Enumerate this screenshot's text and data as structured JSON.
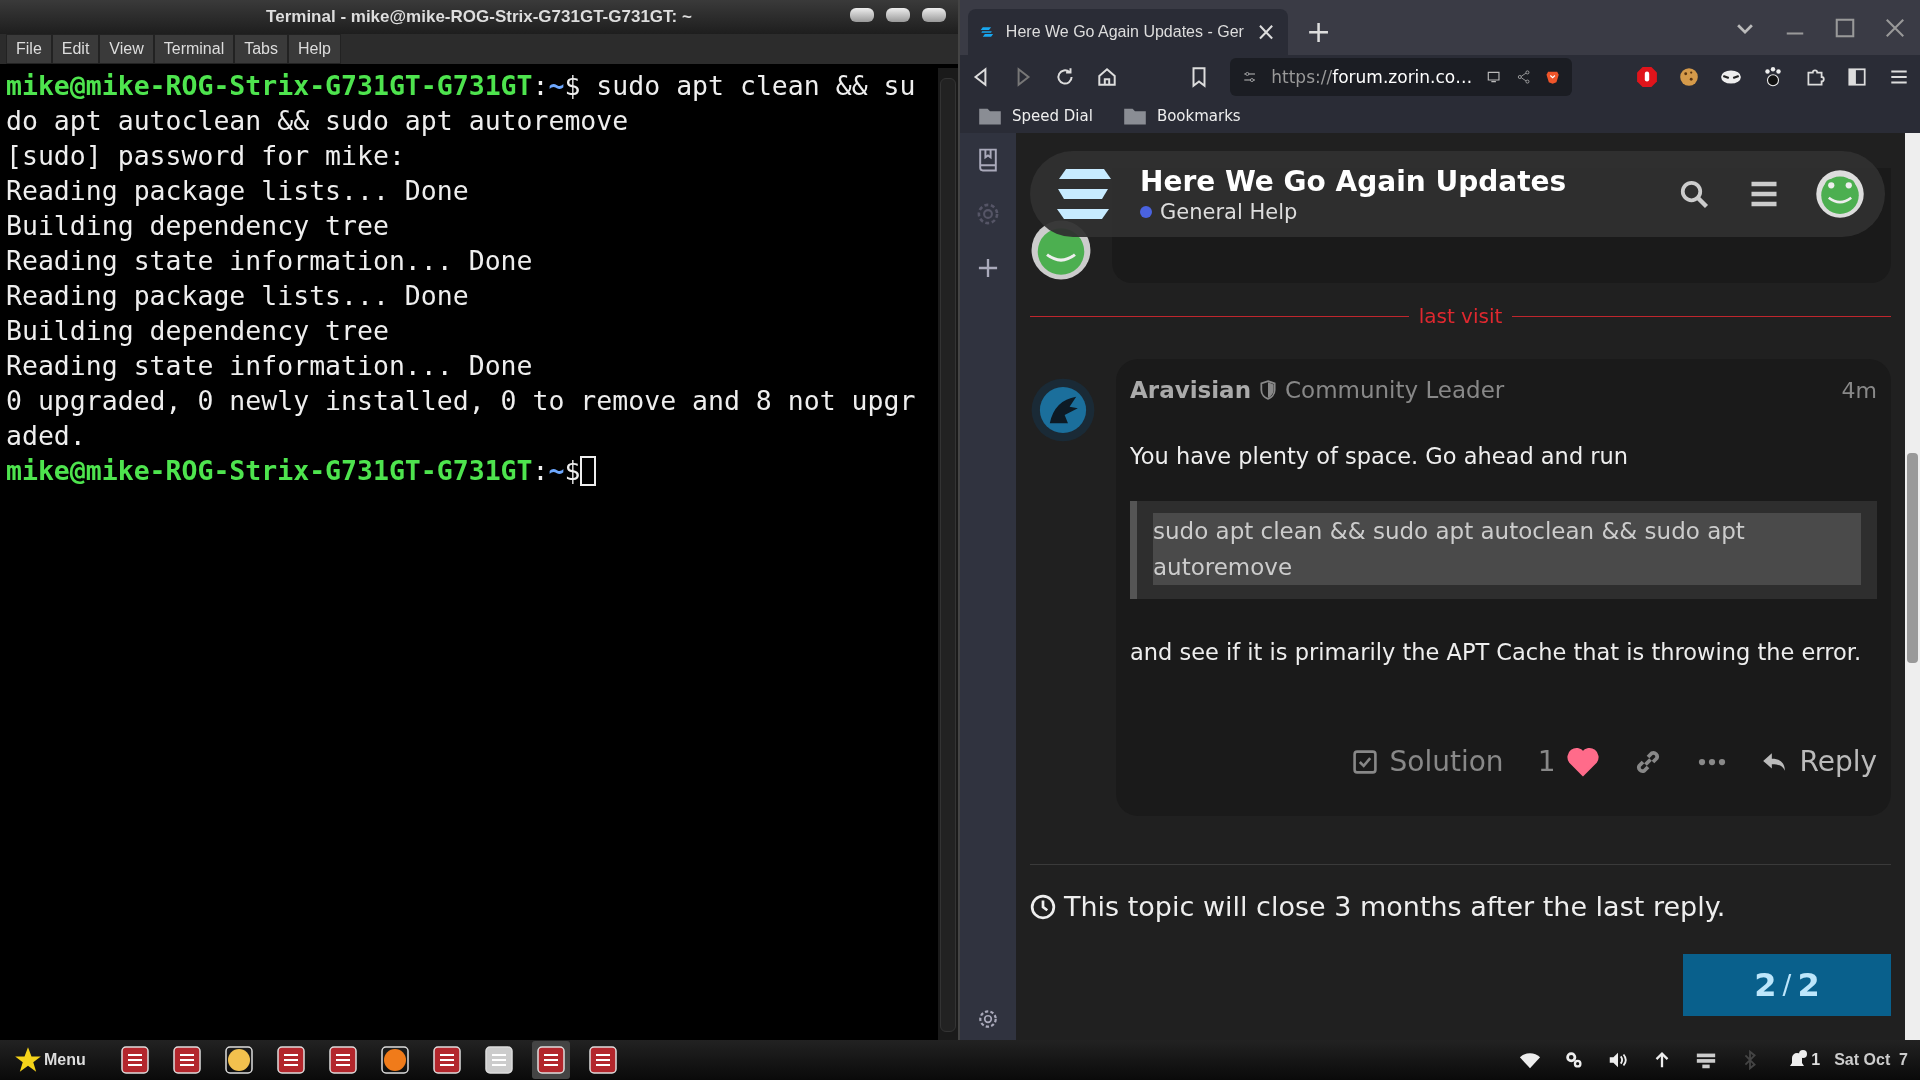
{
  "terminal": {
    "title": "Terminal - mike@mike-ROG-Strix-G731GT-G731GT: ~",
    "menu": [
      "File",
      "Edit",
      "View",
      "Terminal",
      "Tabs",
      "Help"
    ],
    "lines": [
      {
        "kind": "prompt",
        "user": "mike@mike-ROG-Strix-G731GT-G731GT",
        "sep": ":",
        "path": "~",
        "symbol": "$",
        "command": " sudo apt clean && su",
        "cursor": false
      },
      {
        "kind": "output",
        "text": "do apt autoclean && sudo apt autoremove"
      },
      {
        "kind": "output",
        "text": "[sudo] password for mike:"
      },
      {
        "kind": "output",
        "text": "Reading package lists... Done"
      },
      {
        "kind": "output",
        "text": "Building dependency tree"
      },
      {
        "kind": "output",
        "text": "Reading state information... Done"
      },
      {
        "kind": "output",
        "text": "Reading package lists... Done"
      },
      {
        "kind": "output",
        "text": "Building dependency tree"
      },
      {
        "kind": "output",
        "text": "Reading state information... Done"
      },
      {
        "kind": "output",
        "text": "0 upgraded, 0 newly installed, 0 to remove and 8 not upgr"
      },
      {
        "kind": "output",
        "text": "aded."
      },
      {
        "kind": "prompt",
        "user": "mike@mike-ROG-Strix-G731GT-G731GT",
        "sep": ":",
        "path": "~",
        "symbol": "$",
        "cursor": true
      }
    ]
  },
  "browser": {
    "tab": {
      "title": "Here We Go Again Updates - Ger",
      "close": "×",
      "selected": true
    },
    "new_tab": "+",
    "url": {
      "scheme": "https://",
      "host": "forum.zorin.co…"
    },
    "bookmarks": [
      "Speed Dial",
      "Bookmarks"
    ]
  },
  "forum": {
    "header": {
      "title": "Here We Go Again Updates",
      "category": {
        "name": "General Help",
        "color": "#4a63e0"
      }
    },
    "divider": "last visit",
    "post": {
      "author": "Aravisian",
      "role": "Community Leader",
      "time": "4m",
      "text": "You have plenty of space. Go ahead and run",
      "code": {
        "text": "sudo apt clean && sudo apt autoclean && sudo apt autoremove",
        "selected": true
      },
      "text2": "and see if it is primarily the APT Cache that is throwing the error.",
      "actions": {
        "solution": "Solution",
        "likes": "1",
        "liked": true,
        "reply": "Reply"
      }
    },
    "closing_notice": "This topic will close 3 months after the last reply.",
    "timeline": {
      "current": "2",
      "separator": "/",
      "total": "2"
    }
  },
  "taskbar": {
    "menu": "Menu",
    "notifications": "1",
    "clock": "Sat Oct  7"
  }
}
